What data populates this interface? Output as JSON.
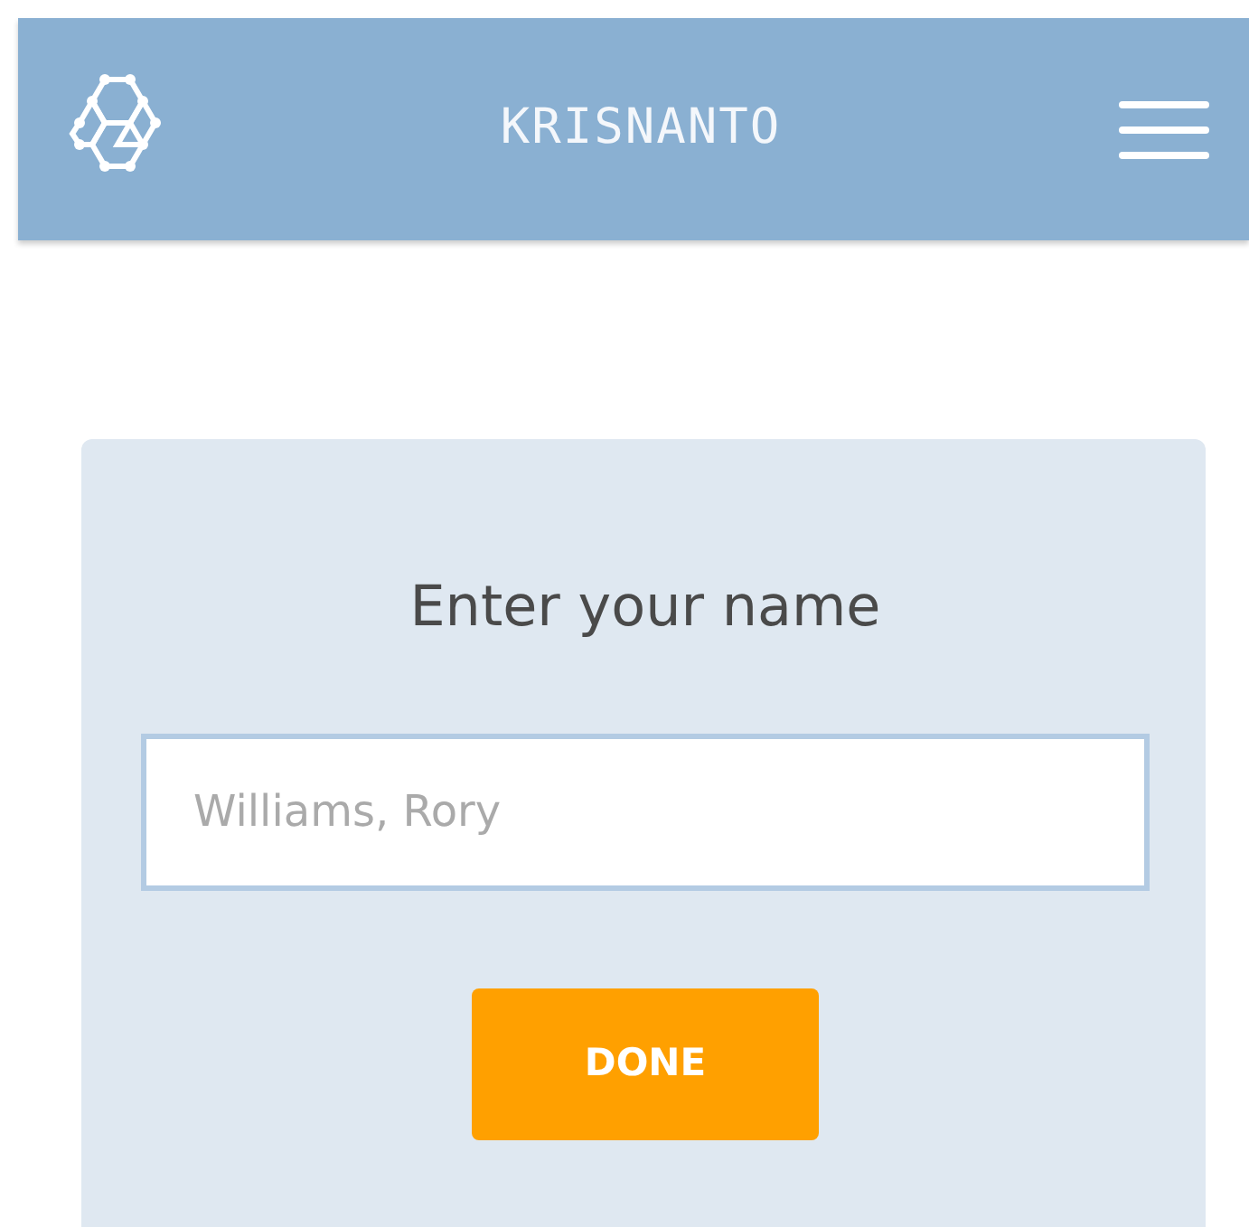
{
  "header": {
    "title": "KRISNANTO"
  },
  "form": {
    "heading": "Enter your name",
    "name_field": {
      "placeholder": "Williams, Rory"
    },
    "button": "DONE"
  }
}
